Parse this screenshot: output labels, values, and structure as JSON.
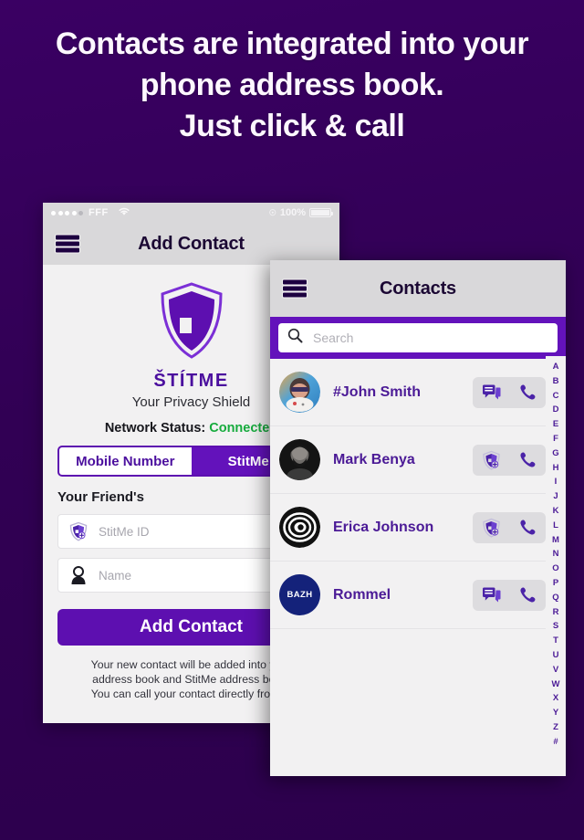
{
  "headline": {
    "line1": "Contacts are integrated into your",
    "line2": "phone address book.",
    "line3": "Just click & call"
  },
  "colors": {
    "background": "#330058",
    "brand_purple": "#5d0fb0",
    "accent_purple": "#6312bb",
    "name_purple": "#4b1a96",
    "status_green": "#16ab3d",
    "phone_bg": "#f2f1f2",
    "navbar_bg": "#d9d8da"
  },
  "phone_left": {
    "status_bar": {
      "carrier": "FFF",
      "wifi_icon": "wifi-icon",
      "rotation_lock_icon": "rotation-lock-icon",
      "battery_percent": "100%",
      "signal_dots_filled": 4,
      "signal_dots_total": 5
    },
    "nav": {
      "menu_icon": "hamburger-menu-icon",
      "title": "Add Contact"
    },
    "logo": {
      "icon": "shield-logo-icon",
      "brand": "ŠTÍTME",
      "tagline": "Your Privacy Shield"
    },
    "network": {
      "label": "Network Status:",
      "value": "Connected"
    },
    "segmented": {
      "tabs": [
        {
          "label": "Mobile Number",
          "active": true
        },
        {
          "label": "StitMe ID",
          "active": false
        }
      ]
    },
    "form": {
      "section_label": "Your Friend's",
      "fields": [
        {
          "icon": "shield-plus-icon",
          "placeholder": "StitMe ID",
          "value": ""
        },
        {
          "icon": "person-icon",
          "placeholder": "Name",
          "value": ""
        }
      ]
    },
    "cta_label": "Add Contact",
    "footer": [
      "Your new contact will be added into your",
      "address book and StitMe address book.",
      "You can call your contact directly from it."
    ]
  },
  "phone_right": {
    "nav": {
      "menu_icon": "hamburger-menu-icon",
      "title": "Contacts"
    },
    "search": {
      "icon": "search-icon",
      "placeholder": "Search",
      "value": ""
    },
    "contacts": [
      {
        "name": "#John Smith",
        "avatar_type": "photo-colorful",
        "avatar_label": "",
        "actions": [
          "chat-icon",
          "phone-icon"
        ]
      },
      {
        "name": "Mark Benya",
        "avatar_type": "photo-bw",
        "avatar_label": "",
        "actions": [
          "shield-plus-icon",
          "phone-icon"
        ]
      },
      {
        "name": "Erica Johnson",
        "avatar_type": "eye-logo",
        "avatar_label": "",
        "actions": [
          "shield-plus-icon",
          "phone-icon"
        ]
      },
      {
        "name": "Rommel",
        "avatar_type": "text-badge",
        "avatar_label": "BAZH",
        "actions": [
          "chat-icon",
          "phone-icon"
        ]
      }
    ],
    "alpha_index": [
      "A",
      "B",
      "C",
      "D",
      "E",
      "F",
      "G",
      "H",
      "I",
      "J",
      "K",
      "L",
      "M",
      "N",
      "O",
      "P",
      "Q",
      "R",
      "S",
      "T",
      "U",
      "V",
      "W",
      "X",
      "Y",
      "Z",
      "#"
    ]
  }
}
